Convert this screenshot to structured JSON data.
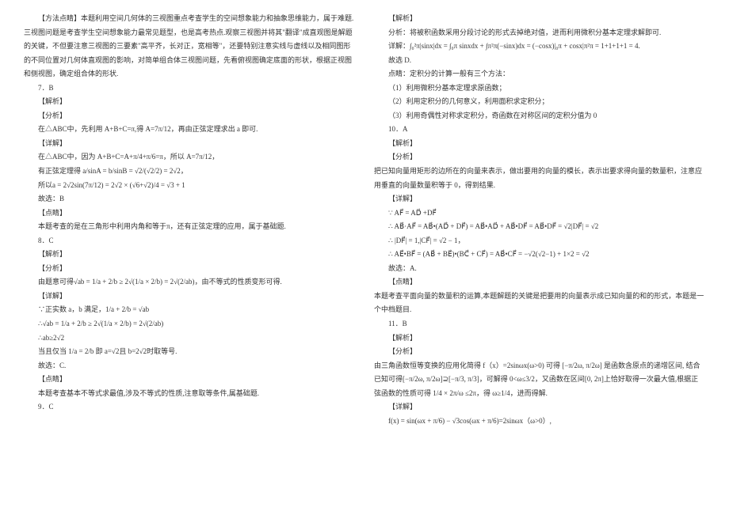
{
  "left": {
    "p1": "【方法点睛】本题利用空间几何体的三视图重点考查学生的空间想象能力和抽象思维能力，属于难题.三视图问题是考查学生空间想象能力最常见题型，也是高考热点.观察三视图并将其\"翻译\"成直观图是解题的关键，不但要注意三视图的三要素\"高平齐，长对正，宽相等\"，还要特别注意实线与虚线以及相同图形的不同位置对几何体直观图的影响，对简单组合体三视图问题，先看俯视图确定底面的形状，根据正视图和侧视图，确定组合体的形状.",
    "p2": "7．B",
    "p3": "【解析】",
    "p4": "【分析】",
    "p5": "在△ABC中，先利用 A+B+C=π,得 A=7π/12，再由正弦定理求出 a 即可.",
    "p6": "【详解】",
    "p7": "在△ABC中，因为 A+B+C=A+π/4+π/6=π，所以 A=7π/12，",
    "p8": "有正弦定理得 a/sinA = b/sinB = √2/(√2/2) = 2√2，",
    "p9": "所以a = 2√2sin(7π/12) = 2√2 × (√6+√2)/4 = √3 + 1",
    "p10": "故选：B",
    "p11": "【点睛】",
    "p12": "本题考查的是在三角形中利用内角和等于π，还有正弦定理的应用，属于基础题.",
    "p13": "8．C",
    "p14": "【解析】",
    "p15": "【分析】",
    "p16": "由题意可得√ab = 1/a + 2/b ≥ 2√(1/a × 2/b) = 2√(2/ab)，由不等式的性质变形可得.",
    "p17": "【详解】",
    "p18": "∵正实数 a，b 满足，1/a + 2/b = √ab",
    "p19": "∴√ab = 1/a + 2/b ≥ 2√(1/a × 2/b) = 2√(2/ab)",
    "p20": "∴ab≥2√2",
    "p21": "当且仅当 1/a = 2/b 即 a=√2且 b=2√2时取等号.",
    "p22": "故选：C.",
    "p23": "【点睛】",
    "p24": "本题考查基本不等式求最值,涉及不等式的性质,注意取等条件,属基础题.",
    "p25": "9．C"
  },
  "right": {
    "p1": "【解析】",
    "p2": "分析：将被积函数采用分段讨论的形式去掉绝对值，进而利用微积分基本定理求解即可.",
    "p3": "详解：∫₀²π|sinx|dx = ∫₀π sinxdx + ∫π²π(−sinx)dx = (−cosx)|₀π + cosx|π²π = 1+1+1+1 = 4.",
    "p4": "故选 D.",
    "p5": "点睛：定积分的计算一般有三个方法：",
    "p6": "（1）利用微积分基本定理求原函数；",
    "p7": "（2）利用定积分的几何意义，利用面积求定积分；",
    "p8": "（3）利用奇偶性对称求定积分，奇函数在对称区间的定积分值为 0",
    "p9": "10．A",
    "p10": "【解析】",
    "p11": "【分析】",
    "p12": "把已知向量用矩形的边所在的向量来表示，做出要用的向量的模长，表示出要求得向量的数量积，注意应用垂直的向量数量积等于 0，得到结果.",
    "p13": "【详解】",
    "p14": "∵ AF⃗ = AD⃗ +DF⃗",
    "p15": "∴ AB⃗·AF⃗ = AB⃗•(AD⃗ + DF⃗) = AB⃗•AD⃗ + AB⃗•DF⃗ = AB⃗•DF⃗ = √2|DF⃗| = √2",
    "p16": "∴ |DF⃗| = 1,|CF⃗| = √2 − 1，",
    "p17": "∴ AE⃗•BF⃗ = (AB⃗ + BE⃗)•(BC⃗ + CF⃗) = AB⃗•CF⃗ = −√2(√2−1) + 1×2 = √2",
    "p18": "故选：A.",
    "p19": "【点睛】",
    "p20": "本题考查平面向量的数量积的运算,本题解题的关键是把要用的向量表示成已知向量的和的形式，本题是一个中档题目.",
    "p21": "11．B",
    "p22": "【解析】",
    "p23": "【分析】",
    "p24": "由三角函数恒等变换的应用化简得 f（x）=2sinωx(ω>0) 可得 [−π/2ω, π/2ω] 是函数含原点的递增区间, 结合已知可得[−π/2ω, π/2ω]⊇[−π/3, π/3]，可解得 0<ω≤3/2，又函数在区间[0, 2π]上恰好取得一次最大值,根据正弦函数的性质可得 1/4 × 2π/ω ≤2π，得 ω≥1/4，进而得解.",
    "p25": "【详解】",
    "p26": "f(x) = sin(ωx + π/6) − √3cos(ωx + π/6)=2sinωx（ω>0）,"
  }
}
